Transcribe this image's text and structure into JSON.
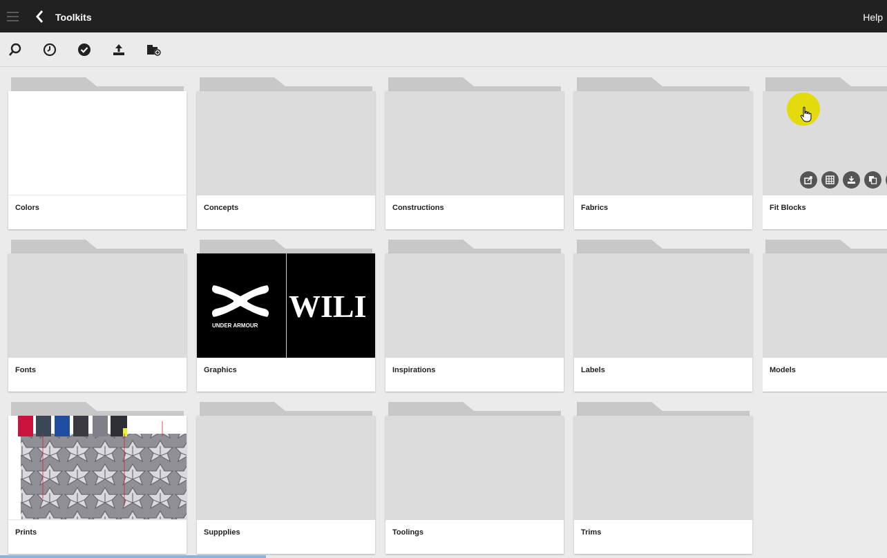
{
  "topbar": {
    "menu_icon": "hamburger-menu-icon",
    "back_icon": "chevron-left-icon",
    "title": "Toolkits",
    "help_label": "Help"
  },
  "toolbar": {
    "icons": [
      "search-icon",
      "clock-history-icon",
      "check-circle-icon",
      "upload-icon",
      "add-folder-icon"
    ]
  },
  "folders": [
    {
      "label": "Colors",
      "thumb": "white"
    },
    {
      "label": "Concepts",
      "thumb": "empty"
    },
    {
      "label": "Constructions",
      "thumb": "empty"
    },
    {
      "label": "Fabrics",
      "thumb": "empty"
    },
    {
      "label": "Fit Blocks",
      "thumb": "empty",
      "hovered": true
    },
    {
      "label": "Fonts",
      "thumb": "empty"
    },
    {
      "label": "Graphics",
      "thumb": "under-armour"
    },
    {
      "label": "Inspirations",
      "thumb": "empty"
    },
    {
      "label": "Labels",
      "thumb": "empty"
    },
    {
      "label": "Models",
      "thumb": "empty"
    },
    {
      "label": "Prints",
      "thumb": "pattern"
    },
    {
      "label": "Suppplies",
      "thumb": "empty"
    },
    {
      "label": "Toolings",
      "thumb": "empty"
    },
    {
      "label": "Trims",
      "thumb": "empty"
    }
  ],
  "graphics_thumb": {
    "logo_caption": "UNDER ARMOUR",
    "wordmark": "WILI"
  },
  "hover_actions": [
    "share-icon",
    "grid-view-icon",
    "download-icon",
    "copy-icon",
    "more-icon"
  ],
  "colors": {
    "topbar": "#212121",
    "background": "#ebebeb",
    "placeholder": "#dcdcdc",
    "folder_tab": "#c8c8c8",
    "cursor_highlight": "#e3da00"
  }
}
